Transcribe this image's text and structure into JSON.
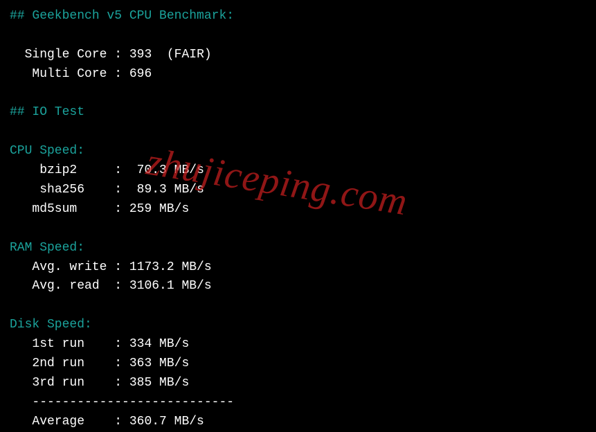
{
  "watermark": "zhujiceping.com",
  "geekbench": {
    "header": "## Geekbench v5 CPU Benchmark:",
    "single_label": "Single Core",
    "single_value": "393",
    "single_rating": "(FAIR)",
    "multi_label": "Multi Core",
    "multi_value": "696"
  },
  "iotest": {
    "header": "## IO Test"
  },
  "cpu": {
    "title": "CPU Speed:",
    "rows": [
      {
        "label": "bzip2",
        "value": "70.3 MB/s"
      },
      {
        "label": "sha256",
        "value": "89.3 MB/s"
      },
      {
        "label": "md5sum",
        "value": "259 MB/s"
      }
    ]
  },
  "ram": {
    "title": "RAM Speed:",
    "rows": [
      {
        "label": "Avg. write",
        "value": "1173.2 MB/s"
      },
      {
        "label": "Avg. read",
        "value": "3106.1 MB/s"
      }
    ]
  },
  "disk": {
    "title": "Disk Speed:",
    "rows": [
      {
        "label": "1st run",
        "value": "334 MB/s"
      },
      {
        "label": "2nd run",
        "value": "363 MB/s"
      },
      {
        "label": "3rd run",
        "value": "385 MB/s"
      }
    ],
    "divider": "---------------------------",
    "avg_label": "Average",
    "avg_value": "360.7 MB/s"
  }
}
